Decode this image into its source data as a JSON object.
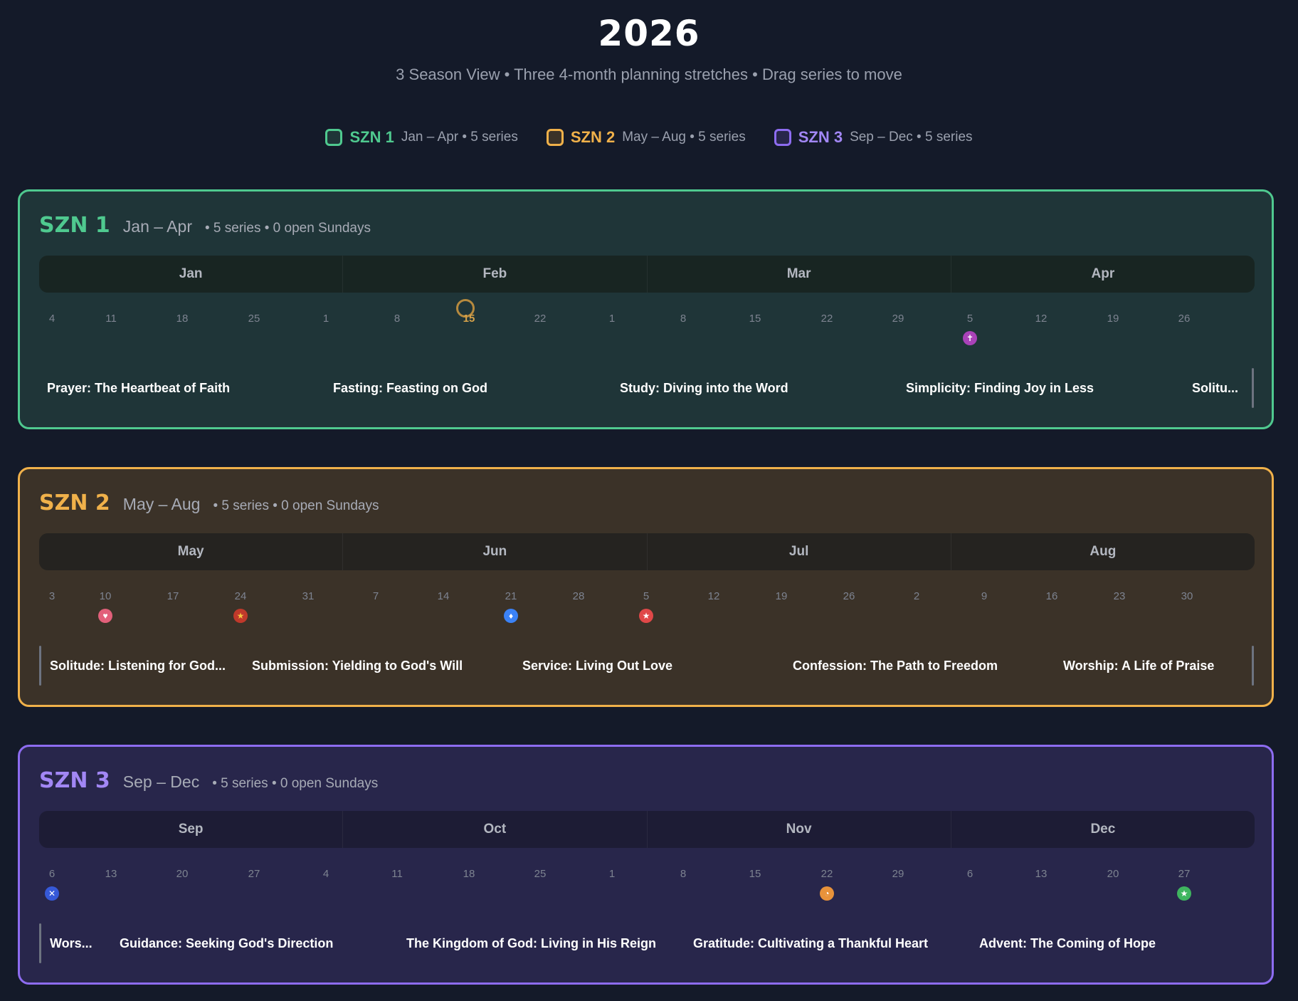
{
  "header": {
    "title": "2026",
    "subtitle": "3 Season View • Three 4-month planning stretches • Drag series to move"
  },
  "colors": {
    "szn1": "#4fc98f",
    "szn2": "#f0b14a",
    "szn3": "#8d6cf0",
    "szn1_bg": "#1f3538",
    "szn2_bg": "#3b3228",
    "szn3_bg": "#28264b",
    "szn1_bar": "#182522",
    "szn2_bar": "#252320",
    "szn3_bar": "#1d1c35"
  },
  "legend": [
    {
      "name": "SZN 1",
      "meta": "Jan – Apr • 5 series"
    },
    {
      "name": "SZN 2",
      "meta": "May – Aug • 5 series"
    },
    {
      "name": "SZN 3",
      "meta": "Sep – Dec • 5 series"
    }
  ],
  "seasons": [
    {
      "name": "SZN 1",
      "range": "Jan – Apr",
      "meta": "• 5 series • 0 open Sundays",
      "months": [
        "Jan",
        "Feb",
        "Mar",
        "Apr"
      ],
      "dates": [
        "4",
        "11",
        "18",
        "25",
        "1",
        "8",
        "15",
        "22",
        "1",
        "8",
        "15",
        "22",
        "29",
        "5",
        "12",
        "19",
        "26"
      ],
      "series": [
        "Prayer: The Heartbeat of Faith",
        "Fasting: Feasting on God",
        "Study: Diving into the Word",
        "Simplicity: Finding Joy in Less",
        "Solitu..."
      ]
    },
    {
      "name": "SZN 2",
      "range": "May – Aug",
      "meta": "• 5 series • 0 open Sundays",
      "months": [
        "May",
        "Jun",
        "Jul",
        "Aug"
      ],
      "dates": [
        "3",
        "10",
        "17",
        "24",
        "31",
        "7",
        "14",
        "21",
        "28",
        "5",
        "12",
        "19",
        "26",
        "2",
        "9",
        "16",
        "23",
        "30"
      ],
      "series": [
        "Solitude: Listening for God...",
        "Submission: Yielding to God's Will",
        "Service: Living Out Love",
        "Confession: The Path to Freedom",
        "Worship: A Life of Praise"
      ]
    },
    {
      "name": "SZN 3",
      "range": "Sep – Dec",
      "meta": "• 5 series • 0 open Sundays",
      "months": [
        "Sep",
        "Oct",
        "Nov",
        "Dec"
      ],
      "dates": [
        "6",
        "13",
        "20",
        "27",
        "4",
        "11",
        "18",
        "25",
        "1",
        "8",
        "15",
        "22",
        "29",
        "6",
        "13",
        "20",
        "27"
      ],
      "series": [
        "Wors...",
        "Guidance: Seeking God's Direction",
        "The Kingdom of God: Living in His Reign",
        "Gratitude: Cultivating a Thankful Heart",
        "Advent: The Coming of Hope"
      ]
    }
  ]
}
